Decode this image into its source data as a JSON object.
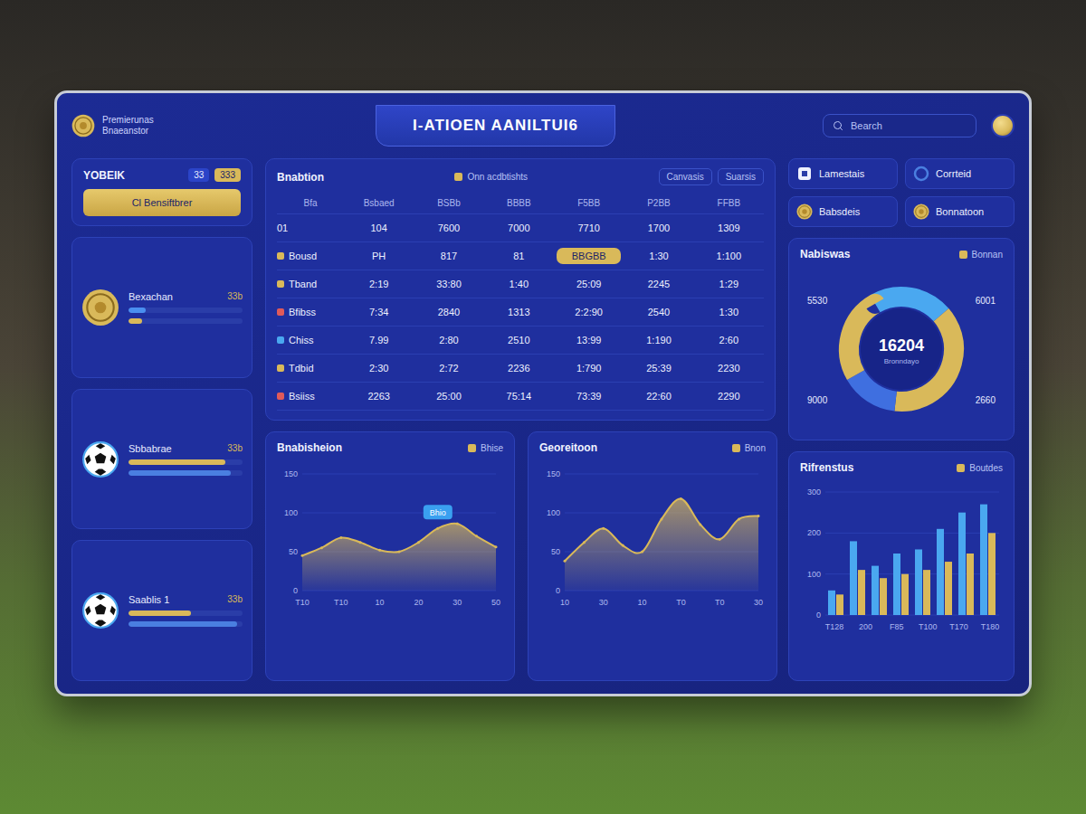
{
  "header": {
    "logo_text": "Premierunas",
    "logo_subtext": "Bnaeanstor",
    "title": "I-ATIOEN AANILTUI6",
    "search": "Bearch"
  },
  "left": {
    "title": "YOBEIK",
    "badges": [
      "33",
      "333"
    ],
    "button": "Cl Bensiftbrer",
    "cards": [
      {
        "kind": "coin",
        "name": "Bexachan",
        "value": "33b",
        "bars": [
          {
            "level": 0.15,
            "color": "#4a8ff0"
          },
          {
            "level": 0.12,
            "color": "#d9b95a"
          }
        ]
      },
      {
        "kind": "ball",
        "name": "Sbbabrae",
        "value": "33b",
        "bars": [
          {
            "level": 0.85,
            "color": "#d9b95a"
          },
          {
            "level": 0.9,
            "color": "#4a7fe0"
          }
        ]
      },
      {
        "kind": "ball",
        "name": "Saablis 1",
        "value": "33b",
        "bars": [
          {
            "level": 0.55,
            "color": "#d9b95a"
          },
          {
            "level": 0.95,
            "color": "#4a7fe0"
          }
        ]
      }
    ]
  },
  "table": {
    "title": "Bnabtion",
    "subtitle": "Onn acdbtishts",
    "actions": [
      "Canvasis",
      "Suarsis"
    ],
    "columns": [
      "Bfa",
      "Bsbaed",
      "BSBb",
      "BBBB",
      "F5BB",
      "P2BB",
      "FFBB"
    ],
    "rows": [
      {
        "label": "01",
        "cells": [
          {
            "text": "104",
            "selected": false
          },
          {
            "text": "7600",
            "selected": false
          },
          {
            "text": "7000",
            "selected": false
          },
          {
            "text": "7710",
            "selected": false
          },
          {
            "text": "1700",
            "selected": false
          },
          {
            "text": "1309",
            "selected": false
          }
        ]
      },
      {
        "label": "Bousd",
        "color": "#d9b95a",
        "cells": [
          {
            "text": "PH",
            "selected": false
          },
          {
            "text": "817",
            "selected": false
          },
          {
            "text": "81",
            "selected": false
          },
          {
            "text": "BBGBB",
            "selected": true
          },
          {
            "text": "1:30",
            "selected": false
          },
          {
            "text": "1:100",
            "selected": false
          }
        ]
      },
      {
        "label": "Tband",
        "color": "#d9b95a",
        "cells": [
          {
            "text": "2:19",
            "selected": false
          },
          {
            "text": "33:80",
            "selected": false
          },
          {
            "text": "1:40",
            "selected": false
          },
          {
            "text": "25:09",
            "selected": false
          },
          {
            "text": "2245",
            "selected": false
          },
          {
            "text": "1:29",
            "selected": false
          }
        ]
      },
      {
        "label": "Bfibss",
        "color": "#e05a5a",
        "cells": [
          {
            "text": "7:34",
            "selected": false
          },
          {
            "text": "2840",
            "selected": false
          },
          {
            "text": "1313",
            "selected": false
          },
          {
            "text": "2:2:90",
            "selected": false
          },
          {
            "text": "2540",
            "selected": false
          },
          {
            "text": "1:30",
            "selected": false
          }
        ]
      },
      {
        "label": "Chiss",
        "color": "#4aa8f0",
        "cells": [
          {
            "text": "7.99",
            "selected": false
          },
          {
            "text": "2:80",
            "selected": false
          },
          {
            "text": "2510",
            "selected": false
          },
          {
            "text": "13:99",
            "selected": false
          },
          {
            "text": "1:190",
            "selected": false
          },
          {
            "text": "2:60",
            "selected": false
          }
        ]
      },
      {
        "label": "Tdbid",
        "color": "#d9b95a",
        "cells": [
          {
            "text": "2:30",
            "selected": false
          },
          {
            "text": "2:72",
            "selected": false
          },
          {
            "text": "2236",
            "selected": false
          },
          {
            "text": "1:790",
            "selected": false
          },
          {
            "text": "25:39",
            "selected": false
          },
          {
            "text": "2230",
            "selected": false
          }
        ]
      },
      {
        "label": "Bsiiss",
        "color": "#e05a5a",
        "cells": [
          {
            "text": "2263",
            "selected": false
          },
          {
            "text": "25:00",
            "selected": false
          },
          {
            "text": "75:14",
            "selected": false
          },
          {
            "text": "73:39",
            "selected": false
          },
          {
            "text": "22:60",
            "selected": false
          },
          {
            "text": "2290",
            "selected": false
          }
        ]
      }
    ]
  },
  "line_charts": [
    {
      "title": "Bnabisheion",
      "legend": "Bhise",
      "tooltip": "Bhio",
      "tooltip_index": 7,
      "max": 150,
      "y_ticks": [
        "150",
        "100",
        "50",
        "0"
      ],
      "x_ticks": [
        "T10",
        "T10",
        "10",
        "20",
        "30",
        "50"
      ],
      "values": [
        45,
        55,
        68,
        62,
        52,
        50,
        62,
        80,
        86,
        70,
        56
      ]
    },
    {
      "title": "Georeitoon",
      "legend": "Bnon",
      "max": 150,
      "y_ticks": [
        "150",
        "100",
        "50",
        "0"
      ],
      "x_ticks": [
        "10",
        "30",
        "10",
        "T0",
        "T0",
        "30"
      ],
      "values": [
        38,
        62,
        80,
        58,
        50,
        92,
        118,
        85,
        66,
        92,
        96
      ]
    }
  ],
  "quick_actions": [
    {
      "label": "Lamestais",
      "kind": "square"
    },
    {
      "label": "Corrteid",
      "kind": "circle"
    },
    {
      "label": "Babsdeis",
      "kind": "coin"
    },
    {
      "label": "Bonnatoon",
      "kind": "coin"
    }
  ],
  "donut": {
    "title": "Nabiswas",
    "legend": "Bonnan",
    "total": "16204",
    "caption": "Bronndayo",
    "segments": [
      {
        "value": 22,
        "color": "#4aa8f0",
        "label": "5530"
      },
      {
        "value": 38,
        "color": "#d9b95a",
        "label": "6001"
      },
      {
        "value": 15,
        "color": "#3f6fe0",
        "label": "2660"
      },
      {
        "value": 25,
        "color": "#d9b95a",
        "label": "9000"
      }
    ]
  },
  "bar_chart": {
    "title": "Rifrenstus",
    "legend": "Boutdes",
    "max": 300,
    "y_ticks": [
      "300",
      "200",
      "100",
      "0"
    ],
    "x_ticks": [
      "T128",
      "200",
      "F85",
      "T100",
      "T170",
      "T180"
    ],
    "series": [
      {
        "color": "#4aa8f0",
        "values": [
          60,
          180,
          120,
          150,
          160,
          210,
          250,
          270
        ]
      },
      {
        "color": "#d9b95a",
        "values": [
          50,
          110,
          90,
          100,
          110,
          130,
          150,
          200
        ]
      }
    ]
  }
}
